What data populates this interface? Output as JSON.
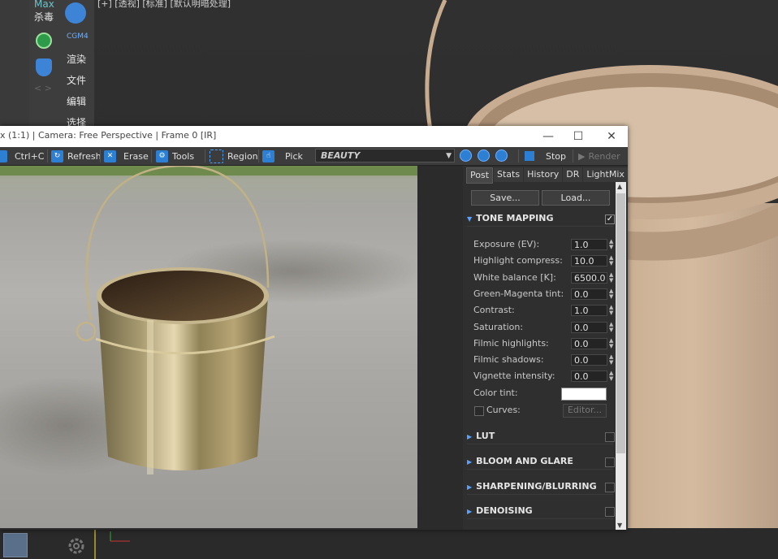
{
  "viewport": {
    "label": "[+] [透视] [标准] [默认明暗处理]",
    "plugin_labels": {
      "max": "Max",
      "antivirus": "杀毒",
      "cgm": "CGM4",
      "render": "渲染",
      "file": "文件",
      "edit": "编辑",
      "select": "选择"
    }
  },
  "vfb": {
    "title": "x (1:1) | Camera: Free Perspective | Frame 0 [IR]",
    "window_buttons": {
      "minimize": "—",
      "maximize": "☐",
      "close": "✕"
    },
    "toolbar": {
      "copy": "Ctrl+C",
      "refresh": "Refresh",
      "erase": "Erase",
      "tools": "Tools",
      "region": "Region",
      "pick": "Pick",
      "channel": "BEAUTY",
      "stop": "Stop",
      "render": "Render"
    },
    "tabs": [
      "Post",
      "Stats",
      "History",
      "DR",
      "LightMix"
    ],
    "active_tab": "Post",
    "buttons": {
      "save": "Save...",
      "load": "Load..."
    },
    "tone_mapping": {
      "title": "TONE MAPPING",
      "enabled_mark": "✓",
      "rows": [
        {
          "label": "Exposure (EV):",
          "value": "1.0"
        },
        {
          "label": "Highlight compress:",
          "value": "10.0"
        },
        {
          "label": "White balance [K]:",
          "value": "6500.0"
        },
        {
          "label": "Green-Magenta tint:",
          "value": "0.0"
        },
        {
          "label": "Contrast:",
          "value": "1.0"
        },
        {
          "label": "Saturation:",
          "value": "0.0"
        },
        {
          "label": "Filmic highlights:",
          "value": "0.0"
        },
        {
          "label": "Filmic shadows:",
          "value": "0.0"
        },
        {
          "label": "Vignette intensity:",
          "value": "0.0"
        }
      ],
      "color_tint_label": "Color tint:",
      "color_tint_value": "#ffffff",
      "curves_label": "Curves:",
      "editor_button": "Editor..."
    },
    "sections": [
      "LUT",
      "BLOOM AND GLARE",
      "SHARPENING/BLURRING",
      "DENOISING"
    ],
    "accent_color": "#2d7fd4"
  }
}
